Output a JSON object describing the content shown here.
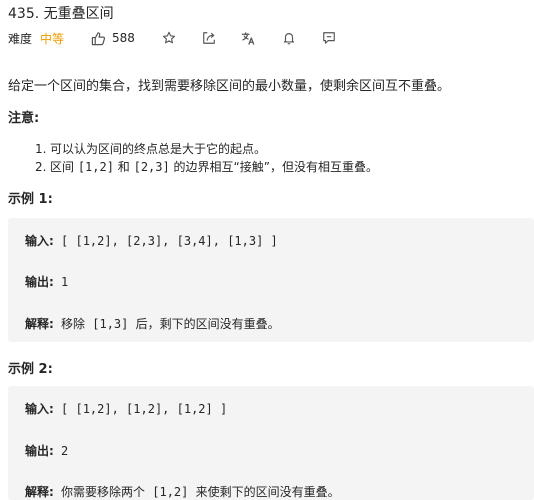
{
  "problem": {
    "title": "435. 无重叠区间",
    "difficulty_label": "难度",
    "difficulty_value": "中等",
    "likes": "588"
  },
  "description": "给定一个区间的集合，找到需要移除区间的最小数量，使剩余区间互不重叠。",
  "notes": {
    "title": "注意:",
    "items": [
      {
        "num": "1.",
        "text": "可以认为区间的终点总是大于它的起点。"
      },
      {
        "num": "2.",
        "pre": "区间 ",
        "code1": "[1,2]",
        "mid": " 和 ",
        "code2": "[2,3]",
        "post": " 的边界相互“接触”，但没有相互重叠。"
      }
    ]
  },
  "examples": [
    {
      "title": "示例 1:",
      "input_label": "输入:",
      "input": " [ [1,2], [2,3], [3,4], [1,3] ]",
      "output_label": "输出:",
      "output": " 1",
      "explain_label": "解释:",
      "explain": " 移除 [1,3] 后，剩下的区间没有重叠。"
    },
    {
      "title": "示例 2:",
      "input_label": "输入:",
      "input": " [ [1,2], [1,2], [1,2] ]",
      "output_label": "输出:",
      "output": " 2",
      "explain_label": "解释:",
      "explain": " 你需要移除两个 [1,2] 来使剩下的区间没有重叠。"
    }
  ],
  "icons": {
    "like": "thumbs-up-icon",
    "star": "star-icon",
    "share": "share-icon",
    "translate": "translate-icon",
    "bell": "bell-icon",
    "note": "note-icon"
  },
  "colors": {
    "difficulty_medium": "#ef9b00",
    "example_background": "#f4f4f4"
  }
}
